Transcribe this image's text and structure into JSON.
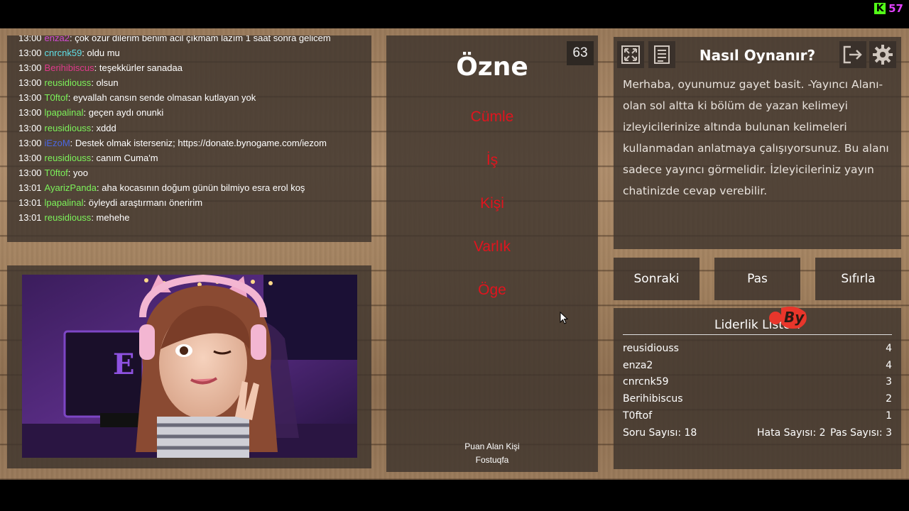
{
  "kick": {
    "logo_letter": "K",
    "viewer_count": "57"
  },
  "chat": {
    "messages": [
      {
        "time": "13:00",
        "user": "enza2",
        "user_color": "#d14bd1",
        "text": ": çok özür dilerim benim acil çıkmam lazım 1 saat sonra gelicem"
      },
      {
        "time": "13:00",
        "user": "cnrcnk59",
        "user_color": "#5fe0e8",
        "text": ": oldu mu"
      },
      {
        "time": "13:00",
        "user": "Berihibiscus",
        "user_color": "#e03a8c",
        "text": ": teşekkürler sanadaa"
      },
      {
        "time": "13:00",
        "user": "reusidiouss",
        "user_color": "#7cf25a",
        "text": ": olsun"
      },
      {
        "time": "13:00",
        "user": "T0ftof",
        "user_color": "#7cf25a",
        "text": ": eyvallah cansın sende olmasan kutlayan yok"
      },
      {
        "time": "13:00",
        "user": "lpapalinal",
        "user_color": "#7cf25a",
        "text": ": geçen aydı onunki"
      },
      {
        "time": "13:00",
        "user": "reusidiouss",
        "user_color": "#7cf25a",
        "text": ": xddd"
      },
      {
        "time": "13:00",
        "user": "iEzoM",
        "user_color": "#4a66e0",
        "text": ": Destek olmak isterseniz; https://donate.bynogame.com/iezom"
      },
      {
        "time": "13:00",
        "user": "reusidiouss",
        "user_color": "#7cf25a",
        "text": ": canım Cuma'm"
      },
      {
        "time": "13:00",
        "user": "T0ftof",
        "user_color": "#7cf25a",
        "text": ": yoo"
      },
      {
        "time": "13:01",
        "user": "AyarizPanda",
        "user_color": "#7cf25a",
        "text": ": aha kocasının doğum günün bilmiyo esra erol koş"
      },
      {
        "time": "13:01",
        "user": "lpapalinal",
        "user_color": "#7cf25a",
        "text": ": öyleydi araştırmanı öneririm"
      },
      {
        "time": "13:01",
        "user": "reusidiouss",
        "user_color": "#7cf25a",
        "text": ": mehehe"
      }
    ]
  },
  "card": {
    "timer": "63",
    "main_word": "Özne",
    "forbidden": [
      "Cümle",
      "İş",
      "Kişi",
      "Varlık",
      "Öge"
    ],
    "scorer_label": "Puan Alan Kişi",
    "scorer_name": "Fostuqfa"
  },
  "howto": {
    "title": "Nasıl Oynanır?",
    "text": "Merhaba, oyunumuz gayet basit. -Yayıncı Alanı- olan sol altta ki bölüm de yazan kelimeyi izleyicilerinize altında bulunan kelimeleri kullanmadan anlatmaya çalışıyorsunuz. Bu alanı sadece yayıncı görmelidir. İzleyicileriniz yayın chatinizde cevap verebilir."
  },
  "buttons": {
    "next": "Sonraki",
    "pass": "Pas",
    "reset": "Sıfırla"
  },
  "leaderboard": {
    "title": "Liderlik Listesi",
    "rows": [
      {
        "name": "reusidiouss",
        "score": "4"
      },
      {
        "name": "enza2",
        "score": "4"
      },
      {
        "name": "cnrcnk59",
        "score": "3"
      },
      {
        "name": "Berihibiscus",
        "score": "2"
      },
      {
        "name": "T0ftof",
        "score": "1"
      }
    ],
    "questions": "Soru Sayısı: 18",
    "errors": "Hata Sayısı: 2",
    "passes": "Pas Sayısı: 3"
  },
  "badge": {
    "text": "By"
  },
  "icons": {
    "fullscreen": "fullscreen-icon",
    "notes": "document-icon",
    "exit": "exit-icon",
    "settings": "gear-icon"
  }
}
